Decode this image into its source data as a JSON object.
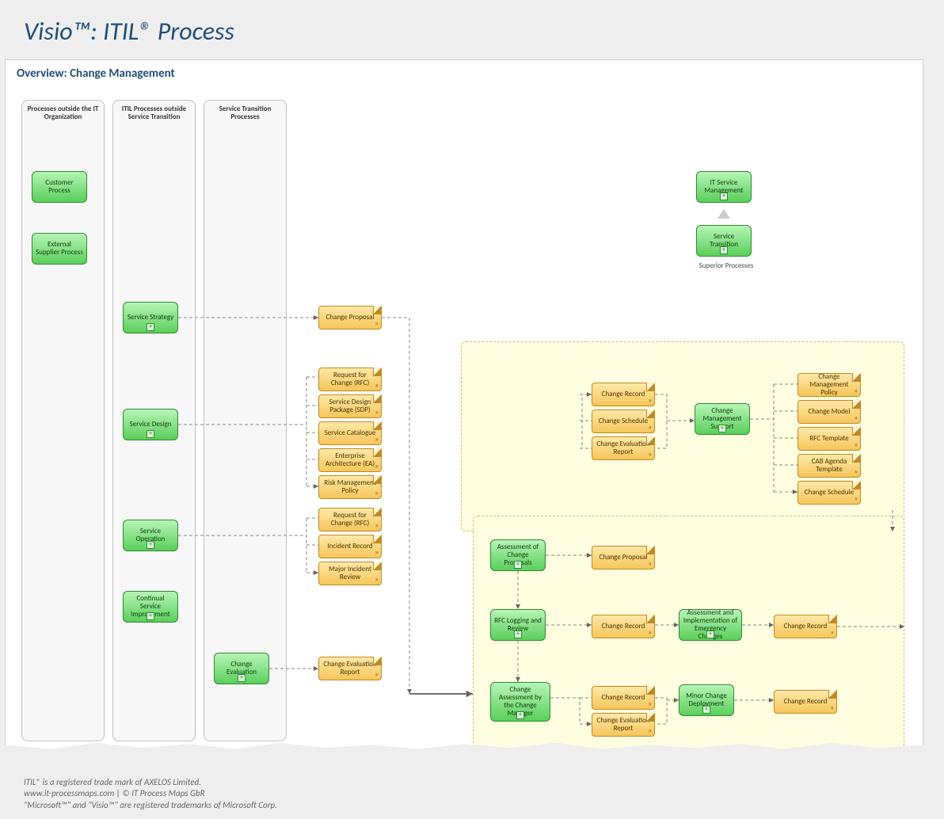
{
  "page": {
    "title": "Visio™: ITIL® Process"
  },
  "overview": {
    "title": "Overview: Change Management"
  },
  "lanes": {
    "l1": "Processes outside the IT Organization",
    "l2": "ITIL Processes outside Service Transition",
    "l3": "Service Transition Processes"
  },
  "proc": {
    "customer": "Customer Process",
    "supplier": "External Supplier Process",
    "strategy": "Service Strategy",
    "design": "Service Design",
    "operation": "Service Operation",
    "csi": "Continual Service Improvement",
    "chgeval": "Change Evaluation",
    "itsm": "IT Service Management",
    "stransition": "Service Transition",
    "cms": "Change Management Support",
    "assessprop": "Assessment of Change Proposals",
    "rfclog": "RFC Logging and Review",
    "assessemerg": "Assessment and Implementation of Emergency Changes",
    "chgassessmgr": "Change Assessment by the Change Manager",
    "minordeploy": "Minor Change Deployment"
  },
  "doc": {
    "chgproposal": "Change Proposal",
    "rfc": "Request for Change (RFC)",
    "sdp": "Service Design Package (SDP)",
    "catalogue": "Service Catalogue",
    "ea": "Enterprise Architecture (EA)",
    "riskpolicy": "Risk Management Policy",
    "incident": "Incident Record",
    "majorinc": "Major Incident Review",
    "chgevalrep": "Change Evaluation Report",
    "chgrecord": "Change Record",
    "chgschedule": "Change Schedule",
    "cmpolicy": "Change Management Policy",
    "chgmodel": "Change Model",
    "rfctmpl": "RFC Template",
    "cabagenda": "CAB Agenda Template"
  },
  "labels": {
    "superior": "Superior Processes"
  },
  "footer": {
    "l1": "ITIL® is a registered trade mark of AXELOS Limited.",
    "l2": "www.it-processmaps.com | © IT Process Maps GbR",
    "l3": "\"Microsoft™\" and \"Visio™\" are registered trademarks of Microsoft Corp."
  }
}
